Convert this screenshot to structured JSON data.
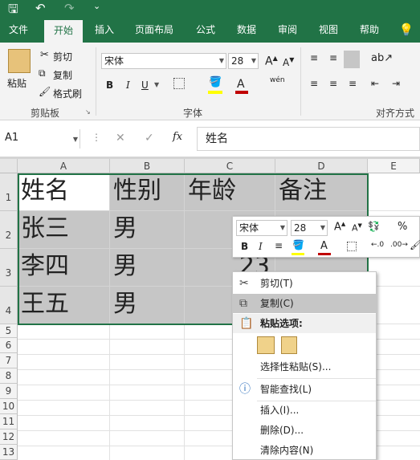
{
  "qat": {
    "save": "🖫",
    "undo": "↶",
    "redo": "↷",
    "more": "⌄"
  },
  "tabs": [
    "文件",
    "开始",
    "插入",
    "页面布局",
    "公式",
    "数据",
    "审阅",
    "视图",
    "帮助"
  ],
  "active_tab": "开始",
  "clipboard": {
    "paste": "粘贴",
    "cut": "剪切",
    "copy": "复制",
    "format_painter": "格式刷",
    "group": "剪贴板"
  },
  "font": {
    "name": "宋体",
    "size": "28",
    "group": "字体",
    "bold": "B",
    "italic": "I",
    "underline": "U",
    "grow": "A",
    "shrink": "A",
    "wen": "wén"
  },
  "align": {
    "group": "对齐方式"
  },
  "formula": {
    "name_box": "A1",
    "fx": "fx",
    "content": "姓名",
    "cancel": "✕",
    "enter": "✓"
  },
  "columns": [
    "A",
    "B",
    "C",
    "D",
    "E"
  ],
  "rows": [
    "1",
    "2",
    "3",
    "4",
    "5",
    "6",
    "7",
    "8",
    "9",
    "10",
    "11",
    "12",
    "13"
  ],
  "cells": [
    [
      "姓名",
      "性别",
      "年龄",
      "备注"
    ],
    [
      "张三",
      "男",
      "",
      ""
    ],
    [
      "李四",
      "男",
      "23",
      ""
    ],
    [
      "王五",
      "男",
      "",
      ""
    ]
  ],
  "mini": {
    "font": "宋体",
    "size": "28",
    "grow": "A",
    "shrink": "A",
    "percent": "%",
    "bold": "B",
    "italic": "I"
  },
  "menu": {
    "cut": "剪切(T)",
    "copy": "复制(C)",
    "paste_options": "粘贴选项:",
    "paste_special": "选择性粘贴(S)...",
    "smart_lookup": "智能查找(L)",
    "insert": "插入(I)...",
    "delete": "删除(D)...",
    "clear": "清除内容(N)"
  },
  "colors": {
    "accent": "#217346",
    "highlight": "#ffff00",
    "font_red": "#c00000"
  }
}
